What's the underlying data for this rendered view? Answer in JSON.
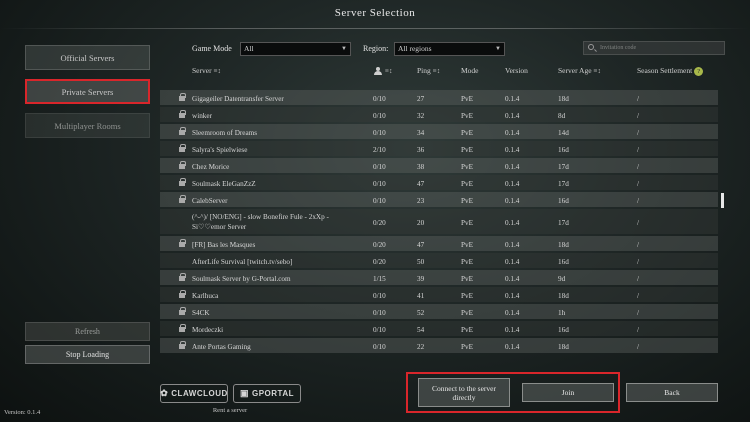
{
  "title": "Server Selection",
  "sidebar": {
    "official": "Official Servers",
    "private": "Private Servers",
    "multiplayer": "Multiplayer Rooms",
    "refresh": "Refresh",
    "stop": "Stop Loading"
  },
  "filters": {
    "game_mode_label": "Game Mode",
    "game_mode_value": "All",
    "region_label": "Region:",
    "region_value": "All regions",
    "search_placeholder": "Invitation code"
  },
  "columns": {
    "server": "Server",
    "players_icon": "person-icon",
    "ping": "Ping",
    "mode": "Mode",
    "version": "Version",
    "age": "Server Age",
    "season": "Season Settlement"
  },
  "rows": [
    {
      "name": "Gigageiler Datentransfer Server",
      "lock": true,
      "players": "0/10",
      "ping": "27",
      "mode": "PvE",
      "version": "0.1.4",
      "age": "18d",
      "season": "/"
    },
    {
      "name": "winker",
      "lock": true,
      "players": "0/10",
      "ping": "32",
      "mode": "PvE",
      "version": "0.1.4",
      "age": "8d",
      "season": "/"
    },
    {
      "name": "Sleemroom of Dreams",
      "lock": true,
      "players": "0/10",
      "ping": "34",
      "mode": "PvE",
      "version": "0.1.4",
      "age": "14d",
      "season": "/"
    },
    {
      "name": "Salyra's Spielwiese",
      "lock": true,
      "players": "2/10",
      "ping": "36",
      "mode": "PvE",
      "version": "0.1.4",
      "age": "16d",
      "season": "/"
    },
    {
      "name": "Chez Morice",
      "lock": true,
      "players": "0/10",
      "ping": "38",
      "mode": "PvE",
      "version": "0.1.4",
      "age": "17d",
      "season": "/"
    },
    {
      "name": "Soulmask EleGanZzZ",
      "lock": true,
      "players": "0/10",
      "ping": "47",
      "mode": "PvE",
      "version": "0.1.4",
      "age": "17d",
      "season": "/"
    },
    {
      "name": "CalebServer",
      "lock": true,
      "players": "0/10",
      "ping": "23",
      "mode": "PvE",
      "version": "0.1.4",
      "age": "16d",
      "season": "/"
    },
    {
      "name": "(^-^)/ [NO/ENG] - slow Bonefire Fule - 2xXp -",
      "name2": "Si♡♡emor Server",
      "lock": false,
      "players": "0/20",
      "ping": "20",
      "mode": "PvE",
      "version": "0.1.4",
      "age": "17d",
      "season": "/"
    },
    {
      "name": "[FR] Bas les Masques",
      "lock": true,
      "players": "0/20",
      "ping": "47",
      "mode": "PvE",
      "version": "0.1.4",
      "age": "18d",
      "season": "/"
    },
    {
      "name": "AfterLife Survival [twitch.tv/sebo]",
      "lock": false,
      "players": "0/20",
      "ping": "50",
      "mode": "PvE",
      "version": "0.1.4",
      "age": "16d",
      "season": "/"
    },
    {
      "name": "Soulmask Server by G-Portal.com",
      "lock": true,
      "players": "1/15",
      "ping": "39",
      "mode": "PvE",
      "version": "0.1.4",
      "age": "9d",
      "season": "/"
    },
    {
      "name": "Karlhuca",
      "lock": true,
      "players": "0/10",
      "ping": "41",
      "mode": "PvE",
      "version": "0.1.4",
      "age": "18d",
      "season": "/"
    },
    {
      "name": "S4CK",
      "lock": true,
      "players": "0/10",
      "ping": "52",
      "mode": "PvE",
      "version": "0.1.4",
      "age": "1h",
      "season": "/"
    },
    {
      "name": "Mordeczki",
      "lock": true,
      "players": "0/10",
      "ping": "54",
      "mode": "PvE",
      "version": "0.1.4",
      "age": "16d",
      "season": "/"
    },
    {
      "name": "Ante Portas Gaming",
      "lock": true,
      "players": "0/10",
      "ping": "22",
      "mode": "PvE",
      "version": "0.1.4",
      "age": "18d",
      "season": "/"
    }
  ],
  "footer": {
    "clawcloud": "CLAWCLOUD",
    "gportal": "GPORTAL",
    "rent": "Rent a server",
    "version": "Version:  0.1.4",
    "connect_line1": "Connect to the server",
    "connect_line2": "directly",
    "join": "Join",
    "back": "Back"
  },
  "colors": {
    "highlight": "#d9262b",
    "help_badge": "#a8b84a"
  }
}
